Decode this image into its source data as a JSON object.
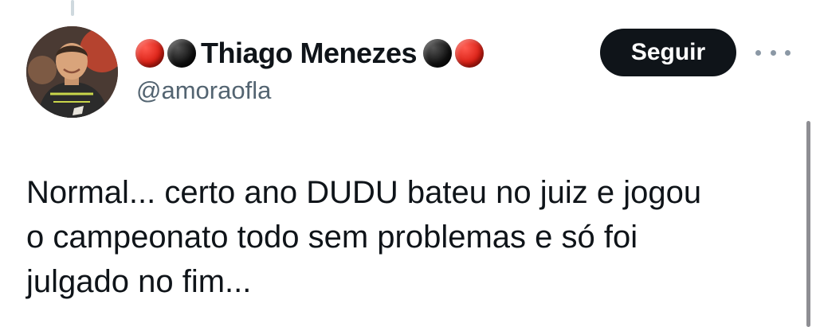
{
  "colors": {
    "follow_bg": "#0f1419",
    "handle": "#536471",
    "text": "#0f1419",
    "dot_red": "#d91f14",
    "dot_black": "#111111"
  },
  "author": {
    "name_prefix_icons": [
      "red-circle-icon",
      "black-circle-icon"
    ],
    "display_name": "Thiago Menezes",
    "name_suffix_icons": [
      "black-circle-icon",
      "red-circle-icon"
    ],
    "handle": "@amoraofla"
  },
  "actions": {
    "follow_label": "Seguir",
    "more_icon": "more-options-icon"
  },
  "tweet": {
    "lines": [
      "Normal... certo ano DUDU bateu no juiz e jogou",
      "o campeonato todo sem problemas e só foi",
      "julgado no fim..."
    ]
  }
}
